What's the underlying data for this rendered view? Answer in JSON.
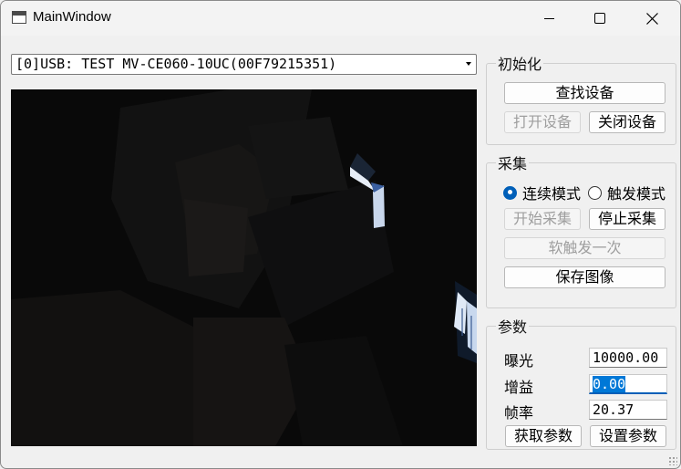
{
  "window": {
    "title": "MainWindow"
  },
  "icons": {
    "app": "window-app-icon",
    "minimize": "minimize-icon",
    "maximize": "maximize-icon",
    "close": "close-icon",
    "dropdown": "chevron-down-icon"
  },
  "device_select": {
    "value": "[0]USB: TEST MV-CE060-10UC(00F79215351)"
  },
  "init_group": {
    "title": "初始化",
    "find_device": "查找设备",
    "open_device": "打开设备",
    "close_device": "关闭设备"
  },
  "capture_group": {
    "title": "采集",
    "mode_continuous": "连续模式",
    "mode_trigger": "触发模式",
    "selected_mode": "continuous",
    "start_capture": "开始采集",
    "stop_capture": "停止采集",
    "soft_trigger": "软触发一次",
    "save_image": "保存图像"
  },
  "param_group": {
    "title": "参数",
    "exposure_label": "曝光",
    "exposure_value": "10000.00",
    "gain_label": "增益",
    "gain_value": "0.00",
    "framerate_label": "帧率",
    "framerate_value": "20.37",
    "get_params": "获取参数",
    "set_params": "设置参数"
  },
  "colors": {
    "accent": "#005fb8",
    "selection": "#0078d7",
    "video_bg": "#090909"
  }
}
